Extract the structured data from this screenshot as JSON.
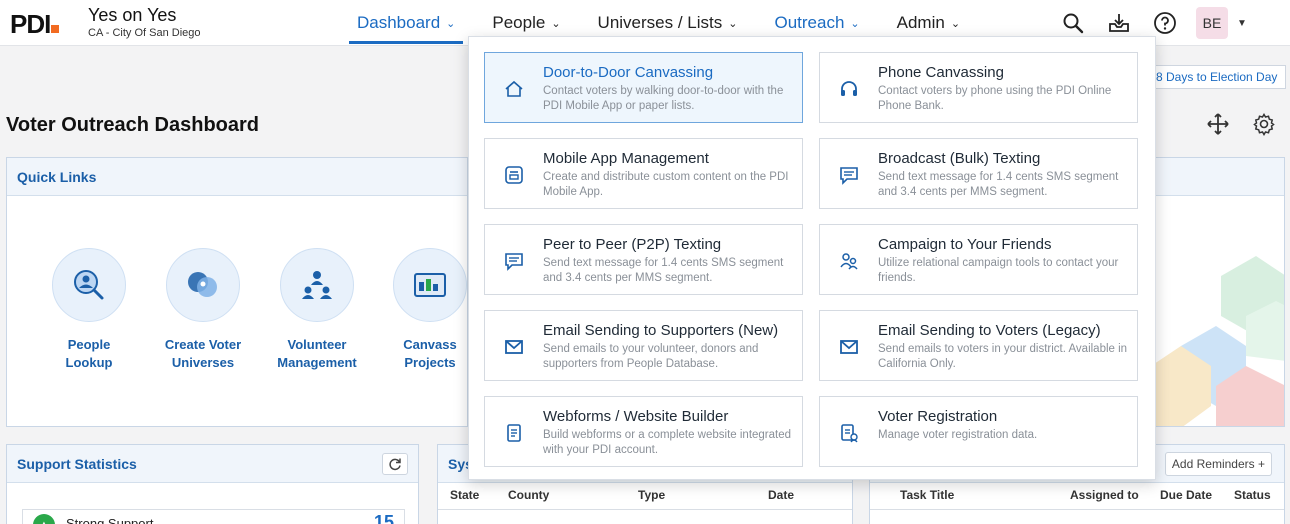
{
  "header": {
    "logo_text": "PDI",
    "org_name": "Yes on Yes",
    "org_sub": "CA - City Of San Diego",
    "nav": [
      {
        "label": "Dashboard"
      },
      {
        "label": "People"
      },
      {
        "label": "Universes / Lists"
      },
      {
        "label": "Outreach"
      },
      {
        "label": "Admin"
      }
    ],
    "avatar_initials": "BE"
  },
  "page": {
    "title": "Voter Outreach Dashboard",
    "election_badge": "8 Days to Election Day"
  },
  "quick_links": {
    "title": "Quick Links",
    "items": [
      {
        "label_line1": "People",
        "label_line2": "Lookup",
        "icon": "people-lookup-icon"
      },
      {
        "label_line1": "Create Voter",
        "label_line2": "Universes",
        "icon": "voter-universes-icon"
      },
      {
        "label_line1": "Volunteer",
        "label_line2": "Management",
        "icon": "volunteer-icon"
      },
      {
        "label_line1": "Canvass",
        "label_line2": "Projects",
        "icon": "canvass-projects-icon"
      }
    ]
  },
  "support_statistics": {
    "title": "Support Statistics",
    "rows": [
      {
        "label": "Strong Support",
        "value": "15"
      }
    ]
  },
  "system_panel": {
    "title_partial": "Sys",
    "columns": [
      "State",
      "County",
      "Type",
      "Date"
    ]
  },
  "tasks_panel": {
    "add_reminders": "Add Reminders",
    "columns": [
      "Task Title",
      "Assigned to",
      "Due Date",
      "Status"
    ]
  },
  "outreach_menu": {
    "items": [
      {
        "title": "Door-to-Door Canvassing",
        "desc": "Contact voters by walking door-to-door with the PDI Mobile App or paper lists.",
        "icon": "home-icon",
        "selected": true
      },
      {
        "title": "Phone Canvassing",
        "desc": "Contact voters by phone using the PDI Online Phone Bank.",
        "icon": "headset-icon"
      },
      {
        "title": "Mobile App Management",
        "desc": "Create and distribute custom content on the PDI Mobile App.",
        "icon": "mobile-app-icon"
      },
      {
        "title": "Broadcast (Bulk) Texting",
        "desc": "Send text message for 1.4 cents SMS segment and 3.4 cents per MMS segment.",
        "icon": "message-icon"
      },
      {
        "title": "Peer to Peer (P2P) Texting",
        "desc": "Send text message for 1.4 cents SMS segment and 3.4 cents per MMS segment.",
        "icon": "message-icon"
      },
      {
        "title": "Campaign to Your Friends",
        "desc": "Utilize relational campaign tools to contact your friends.",
        "icon": "friends-icon"
      },
      {
        "title": "Email Sending to Supporters (New)",
        "desc": "Send emails to your volunteer, donors and supporters from People Database.",
        "icon": "email-icon"
      },
      {
        "title": "Email Sending to Voters (Legacy)",
        "desc": "Send emails to voters in your district. Available in California Only.",
        "icon": "email-icon"
      },
      {
        "title": "Webforms / Website Builder",
        "desc": "Build webforms or a complete website integrated with your PDI account.",
        "icon": "webform-icon"
      },
      {
        "title": "Voter Registration",
        "desc": "Manage voter registration data.",
        "icon": "voter-registration-icon"
      }
    ]
  },
  "colors": {
    "accent": "#1b6bc2",
    "brand_orange": "#f26b21",
    "support_green": "#2aa84a"
  }
}
